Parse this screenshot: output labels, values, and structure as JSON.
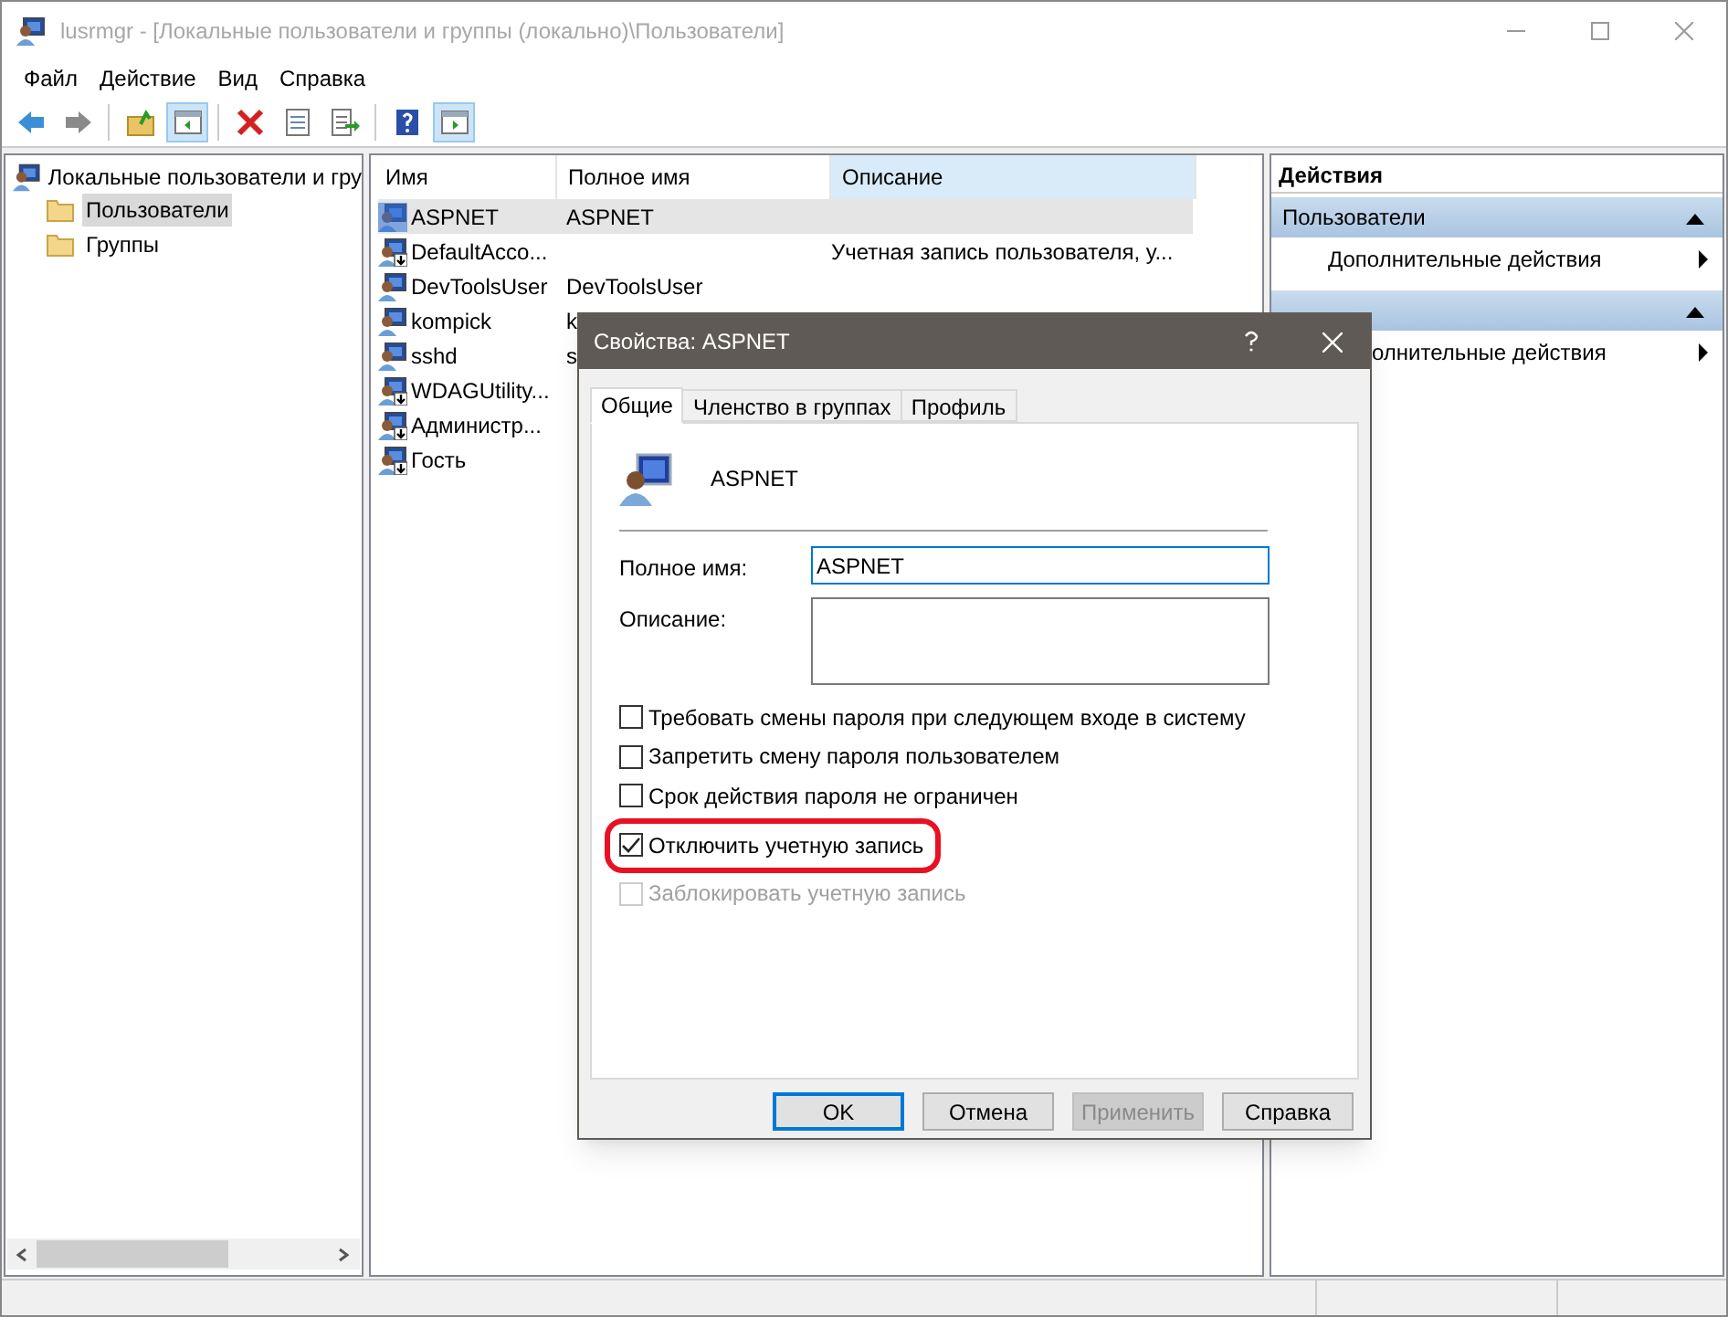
{
  "window": {
    "title": "lusrmgr - [Локальные пользователи и группы (локально)\\Пользователи]"
  },
  "menu": [
    "Файл",
    "Действие",
    "Вид",
    "Справка"
  ],
  "toolbar": [
    {
      "kind": "back",
      "pressed": false
    },
    {
      "kind": "forward",
      "pressed": false
    },
    {
      "kind": "up",
      "pressed": false
    },
    {
      "kind": "tree",
      "pressed": true
    },
    {
      "kind": "delete",
      "pressed": false
    },
    {
      "kind": "properties",
      "pressed": false
    },
    {
      "kind": "export",
      "pressed": false
    },
    {
      "kind": "help",
      "pressed": false
    },
    {
      "kind": "actions",
      "pressed": true
    }
  ],
  "tree": {
    "root": "Локальные пользователи и гру",
    "children": [
      {
        "label": "Пользователи",
        "selected": true
      },
      {
        "label": "Группы",
        "selected": false
      }
    ]
  },
  "list": {
    "columns": [
      {
        "label": "Имя",
        "sorted": false
      },
      {
        "label": "Полное имя",
        "sorted": false
      },
      {
        "label": "Описание",
        "sorted": true
      }
    ],
    "rows": [
      {
        "name": "ASPNET",
        "full_name": "ASPNET",
        "selected": true,
        "disabled": false
      },
      {
        "name": "DefaultAcco...",
        "description": "Учетная запись пользователя, у...",
        "selected": false,
        "disabled": true
      },
      {
        "name": "DevToolsUser",
        "full_name": "DevToolsUser",
        "selected": false,
        "disabled": false
      },
      {
        "name": "kompick",
        "full_name": "k",
        "selected": false,
        "disabled": false
      },
      {
        "name": "sshd",
        "full_name": "s",
        "selected": false,
        "disabled": false
      },
      {
        "name": "WDAGUtility...",
        "selected": false,
        "disabled": true
      },
      {
        "name": "Администр...",
        "selected": false,
        "disabled": true
      },
      {
        "name": "Гость",
        "selected": false,
        "disabled": true
      }
    ]
  },
  "actions": {
    "title": "Действия",
    "groups": [
      {
        "title": "Пользователи",
        "items": [
          "Дополнительные действия"
        ]
      },
      {
        "items": [
          "олнительные действия"
        ]
      }
    ]
  },
  "dialog": {
    "title": "Свойства: ASPNET",
    "tabs": [
      {
        "label": "Общие",
        "selected": true
      },
      {
        "label": "Членство в группах",
        "selected": false
      },
      {
        "label": "Профиль",
        "selected": false
      }
    ],
    "user_name": "ASPNET",
    "fields": [
      {
        "label": "Полное имя:",
        "value": "ASPNET",
        "kind": "line",
        "focused": true
      },
      {
        "label": "Описание:",
        "kind": "multiline",
        "focused": false
      }
    ],
    "checkboxes": [
      {
        "label": "Требовать смены пароля при следующем входе в систему",
        "checked": false,
        "disabled": false,
        "highlighted": false
      },
      {
        "label": "Запретить смену пароля пользователем",
        "checked": false,
        "disabled": false,
        "highlighted": false
      },
      {
        "label": "Срок действия пароля не ограничен",
        "checked": false,
        "disabled": false,
        "highlighted": false
      },
      {
        "label": "Отключить учетную запись",
        "checked": true,
        "disabled": false,
        "highlighted": true
      },
      {
        "label": "Заблокировать учетную запись",
        "checked": false,
        "disabled": true,
        "highlighted": false
      }
    ],
    "buttons": [
      {
        "label": "OK",
        "default": true,
        "disabled": false
      },
      {
        "label": "Отмена",
        "default": false,
        "disabled": false
      },
      {
        "label": "Применить",
        "default": false,
        "disabled": true
      },
      {
        "label": "Справка",
        "default": false,
        "disabled": false
      }
    ]
  }
}
